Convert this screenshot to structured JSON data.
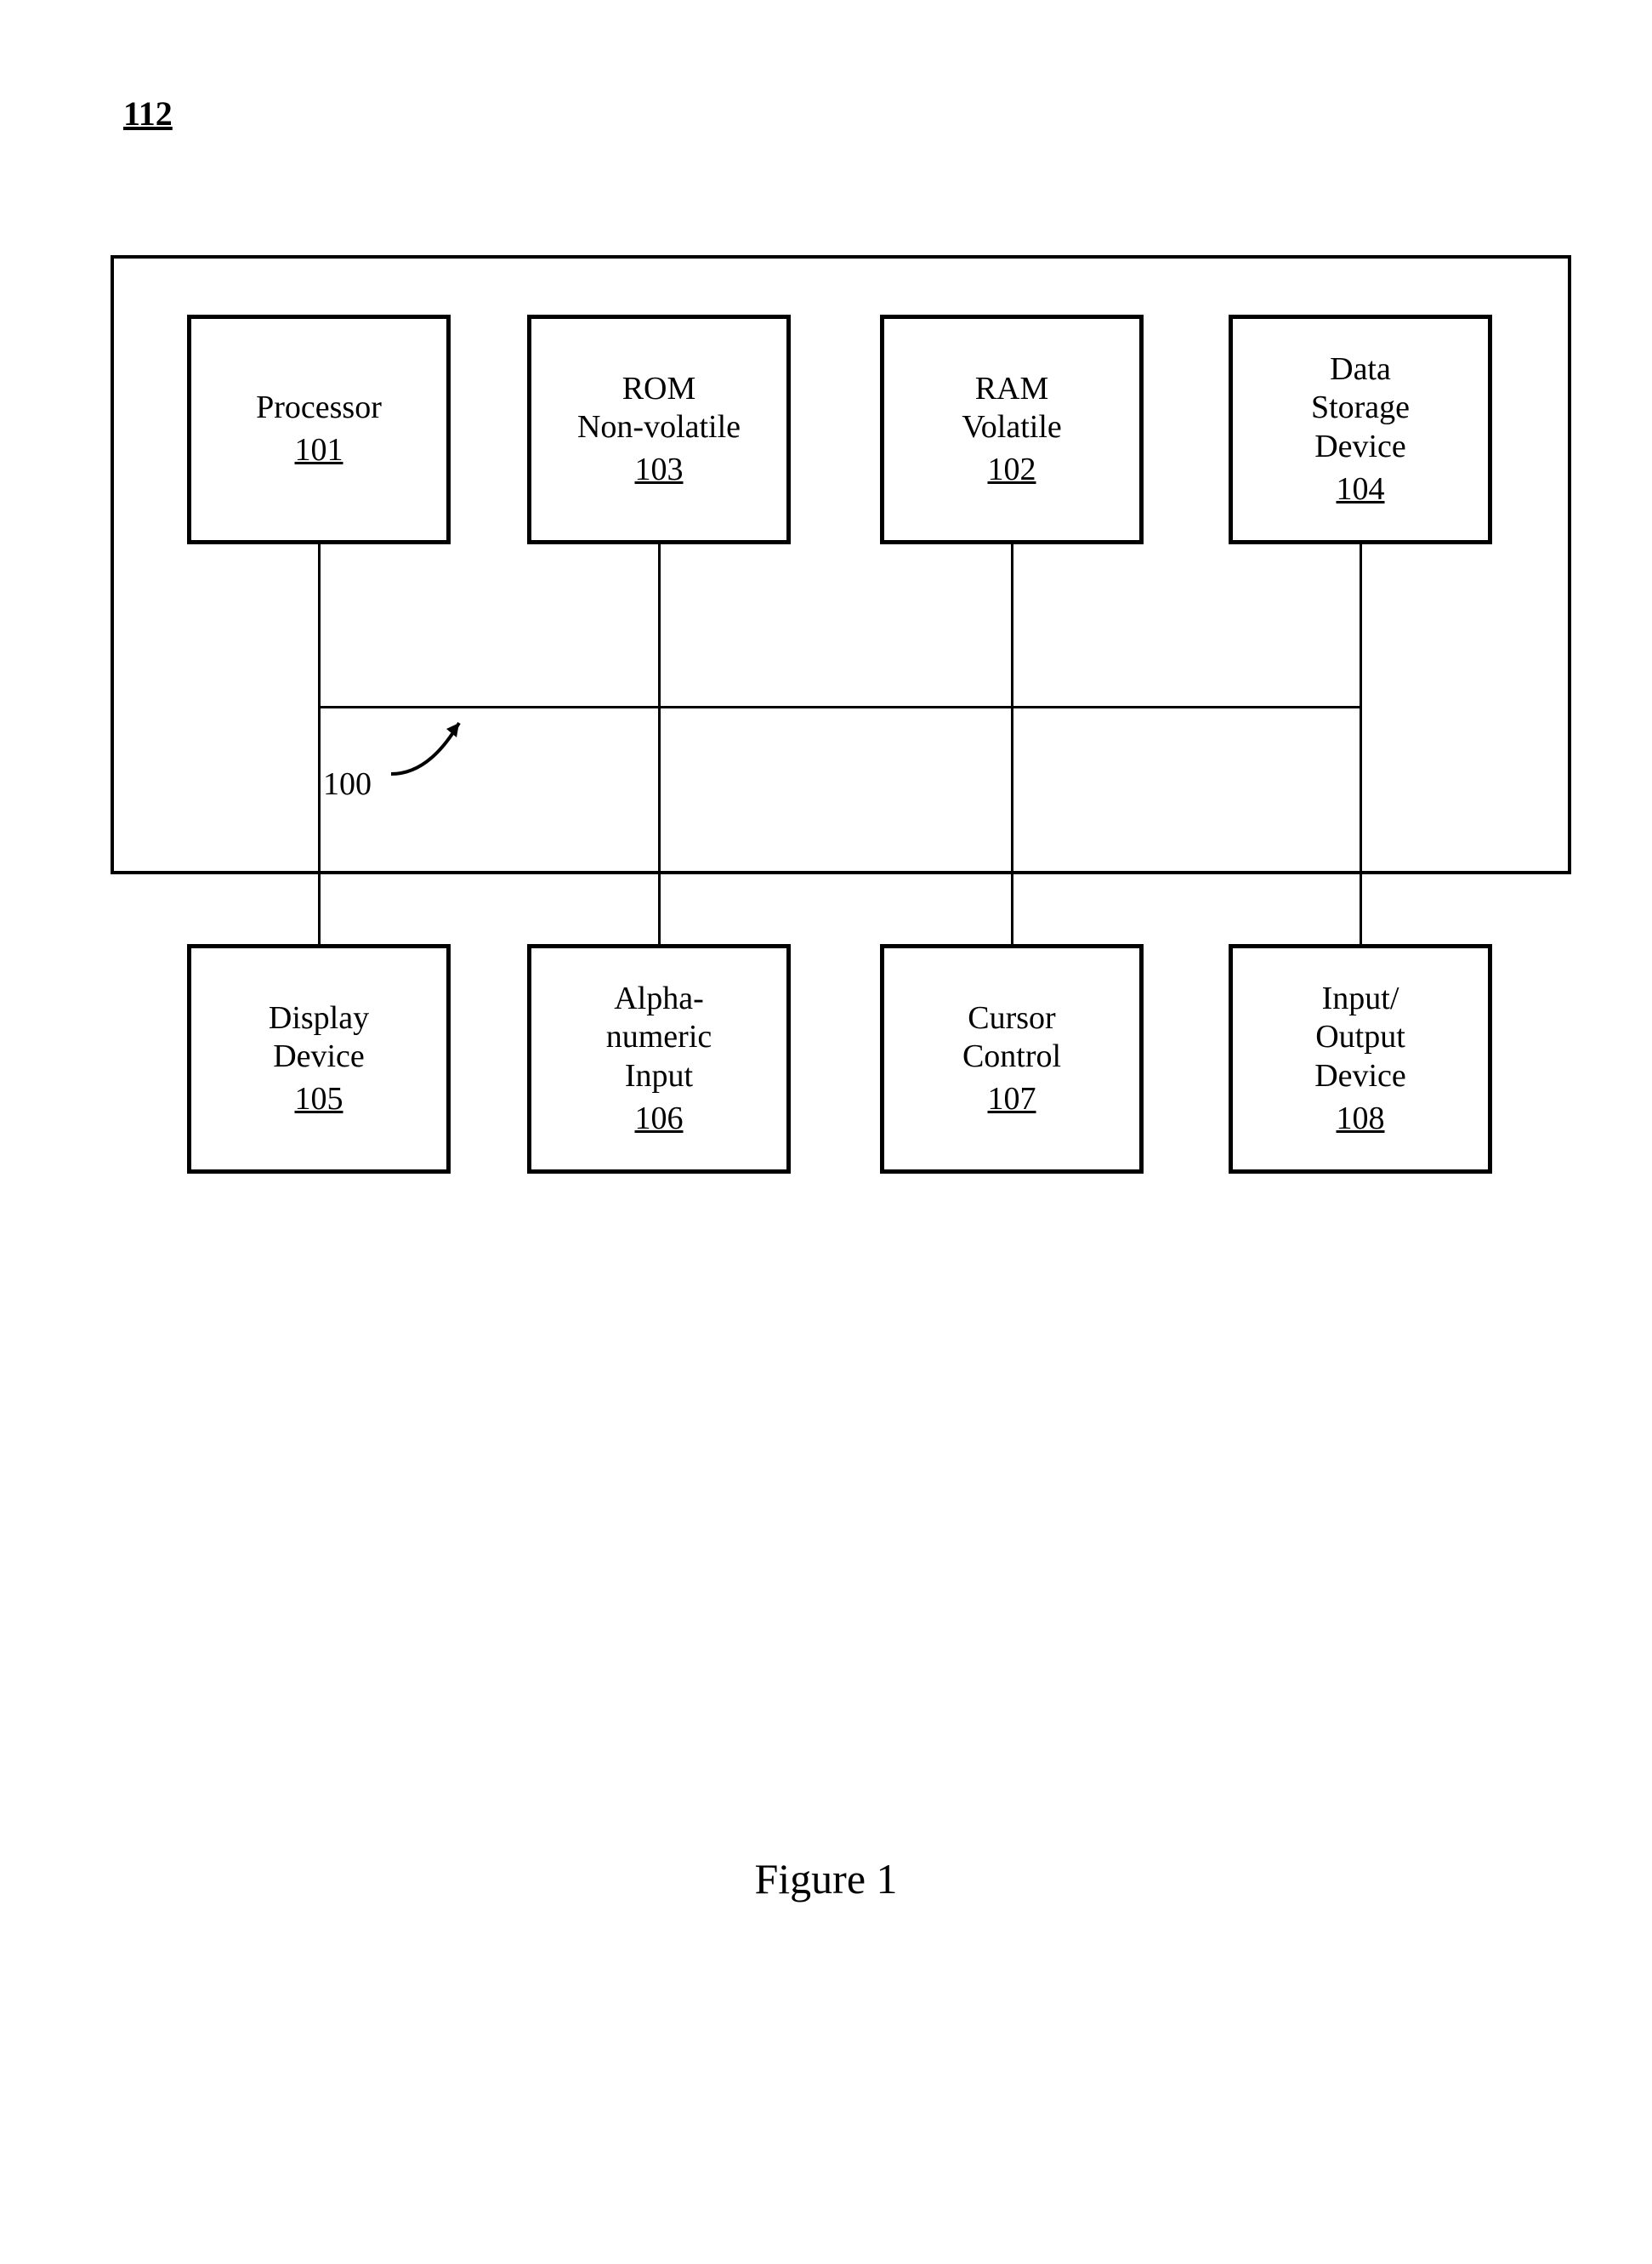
{
  "system_ref": "112",
  "bus_ref": "100",
  "caption": "Figure 1",
  "blocks": {
    "processor": {
      "line1": "Processor",
      "ref": "101"
    },
    "rom": {
      "line1": "ROM",
      "line2": "Non-volatile",
      "ref": "103"
    },
    "ram": {
      "line1": "RAM",
      "line2": "Volatile",
      "ref": "102"
    },
    "storage": {
      "line1": "Data",
      "line2": "Storage",
      "line3": "Device",
      "ref": "104"
    },
    "display": {
      "line1": "Display",
      "line2": "Device",
      "ref": "105"
    },
    "alpha": {
      "line1": "Alpha-",
      "line2": "numeric",
      "line3": "Input",
      "ref": "106"
    },
    "cursor": {
      "line1": "Cursor",
      "line2": "Control",
      "ref": "107"
    },
    "io": {
      "line1": "Input/",
      "line2": "Output",
      "line3": "Device",
      "ref": "108"
    }
  }
}
